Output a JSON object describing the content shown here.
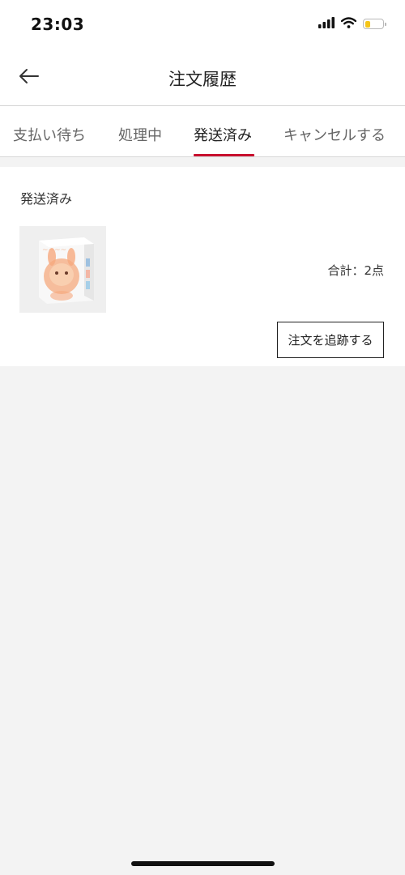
{
  "status_bar": {
    "time": "23:03",
    "battery_level": 0.3,
    "battery_color": "#f5c518"
  },
  "header": {
    "title": "注文履歴",
    "back_icon": "arrow-left-icon"
  },
  "tabs": [
    {
      "label": "支払い待ち",
      "active": false
    },
    {
      "label": "処理中",
      "active": false
    },
    {
      "label": "発送済み",
      "active": true
    },
    {
      "label": "キャンセルする",
      "active": false
    }
  ],
  "accent_color": "#c8102e",
  "order": {
    "status": "発送済み",
    "total": "合計：2点",
    "track_button": "注文を追跡する"
  }
}
